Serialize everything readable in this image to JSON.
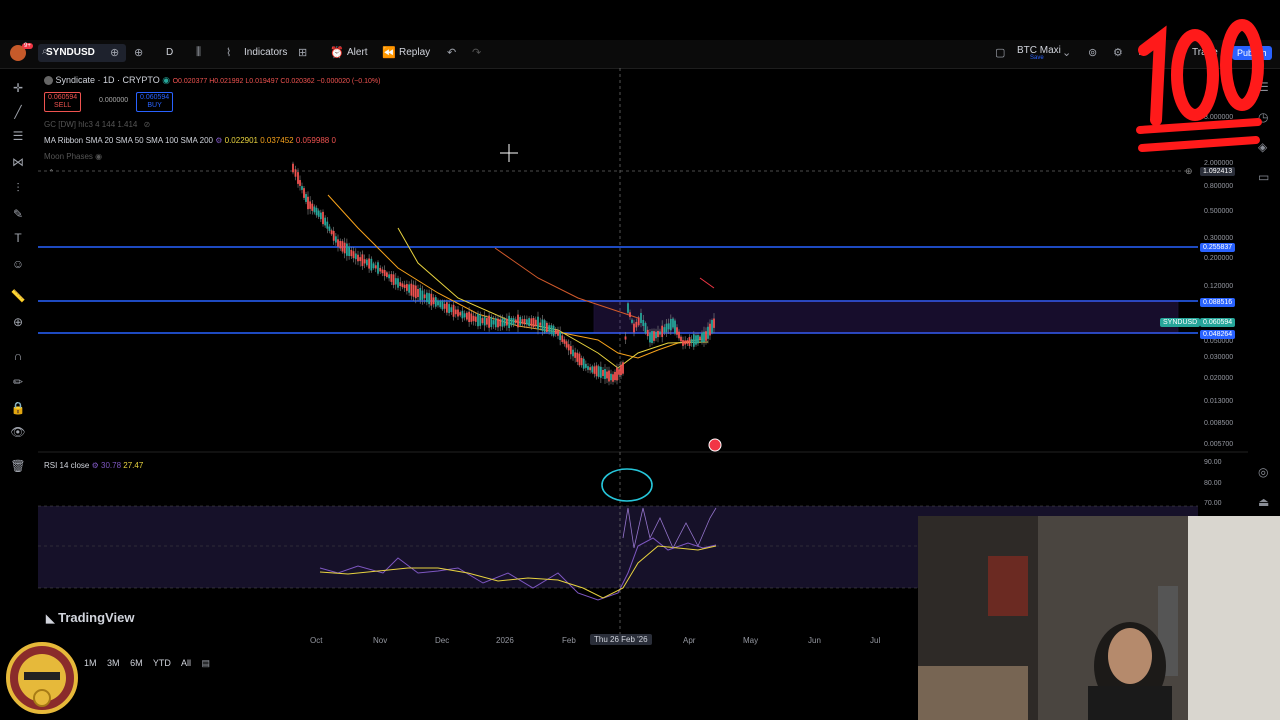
{
  "topbar": {
    "symbol": "SYNDUSD",
    "interval": "D",
    "indicators": "Indicators",
    "alert": "Alert",
    "replay": "Replay",
    "layout_name": "BTC Maxi",
    "layout_sub": "Save",
    "trade": "Trade",
    "publish": "Publish",
    "notif_badge": "9+"
  },
  "legend": {
    "title": "Syndicate · 1D · CRYPTO",
    "ohlc": "O0.020377 H0.021992 L0.019497 C0.020362 −0.000020 (−0.10%)",
    "sell_price": "0.060594",
    "sell_label": "SELL",
    "spread": "0.000000",
    "buy_price": "0.060594",
    "buy_label": "BUY",
    "gc_line": "GC [DW] hlc3 4 144 1.414",
    "ma_label": "MA Ribbon SMA 20 SMA 50 SMA 100 SMA 200",
    "ma_values": [
      "0.022901",
      "0.037452",
      "0.059988",
      "0"
    ],
    "moon": "Moon Phases"
  },
  "price_axis": {
    "ticks": [
      "3.000000",
      "2.000000",
      "0.800000",
      "0.500000",
      "0.300000",
      "0.200000",
      "0.120000",
      "0.050000",
      "0.030000",
      "0.020000",
      "0.013000",
      "0.008500",
      "0.005700"
    ],
    "crosshair_tag": "1.092413",
    "tag_upper": "0.255837",
    "tag_mid": "0.088516",
    "tag_current_symbol": "SYNDUSD",
    "tag_current": "0.060594",
    "tag_lower": "0.048264"
  },
  "rsi": {
    "label": "RSI 14 close",
    "value1": "30.78",
    "value2": "27.47",
    "ticks": [
      "90.00",
      "80.00",
      "70.00"
    ]
  },
  "time_axis": {
    "labels": [
      "Oct",
      "Nov",
      "Dec",
      "2026",
      "Feb",
      "Apr",
      "May",
      "Jun",
      "Jul"
    ],
    "crosshair": "Thu 26 Feb '26"
  },
  "ranges": [
    "1M",
    "3M",
    "6M",
    "YTD",
    "All"
  ],
  "watermark": "TradingView",
  "colors": {
    "up": "#26a69a",
    "down": "#ef5350",
    "blue_line": "#2962ff",
    "ma_orange": "#f7a21b",
    "ma_yellow": "#e8d33f",
    "rsi_purple": "#7e57c2"
  }
}
